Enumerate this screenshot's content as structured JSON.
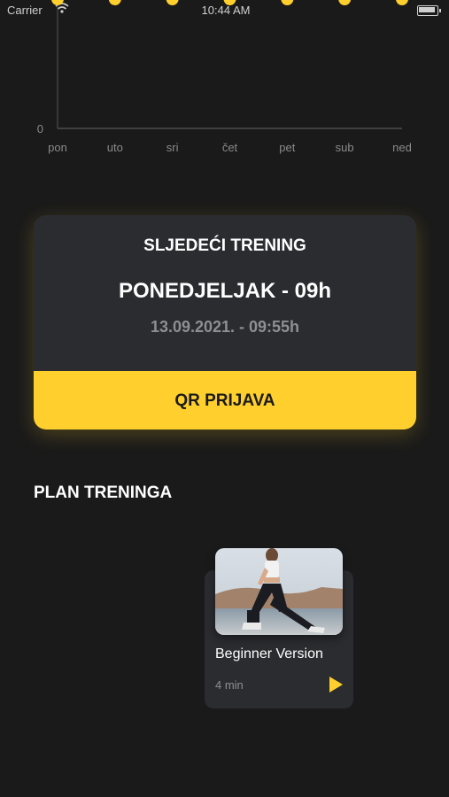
{
  "status_bar": {
    "carrier": "Carrier",
    "time": "10:44 AM"
  },
  "colors": {
    "background": "#1a1a1a",
    "card": "#2b2c30",
    "accent": "#ffcf2e",
    "muted_text": "#8e8e93"
  },
  "chart_data": {
    "type": "line",
    "categories": [
      "pon",
      "uto",
      "sri",
      "čet",
      "pet",
      "sub",
      "ned"
    ],
    "y_tick_labels": [
      "0"
    ],
    "ylim": [
      0,
      null
    ],
    "grid": false
  },
  "next_training": {
    "title": "SLJEDEĆI TRENING",
    "day": "PONEDJELJAK - 09h",
    "date": "13.09.2021. - 09:55h",
    "button_label": "QR PRIJAVA"
  },
  "plan": {
    "title": "PLAN TRENINGA",
    "items": [
      {
        "name": "Beginner Version",
        "duration": "4 min",
        "icon": "play-icon"
      }
    ]
  }
}
